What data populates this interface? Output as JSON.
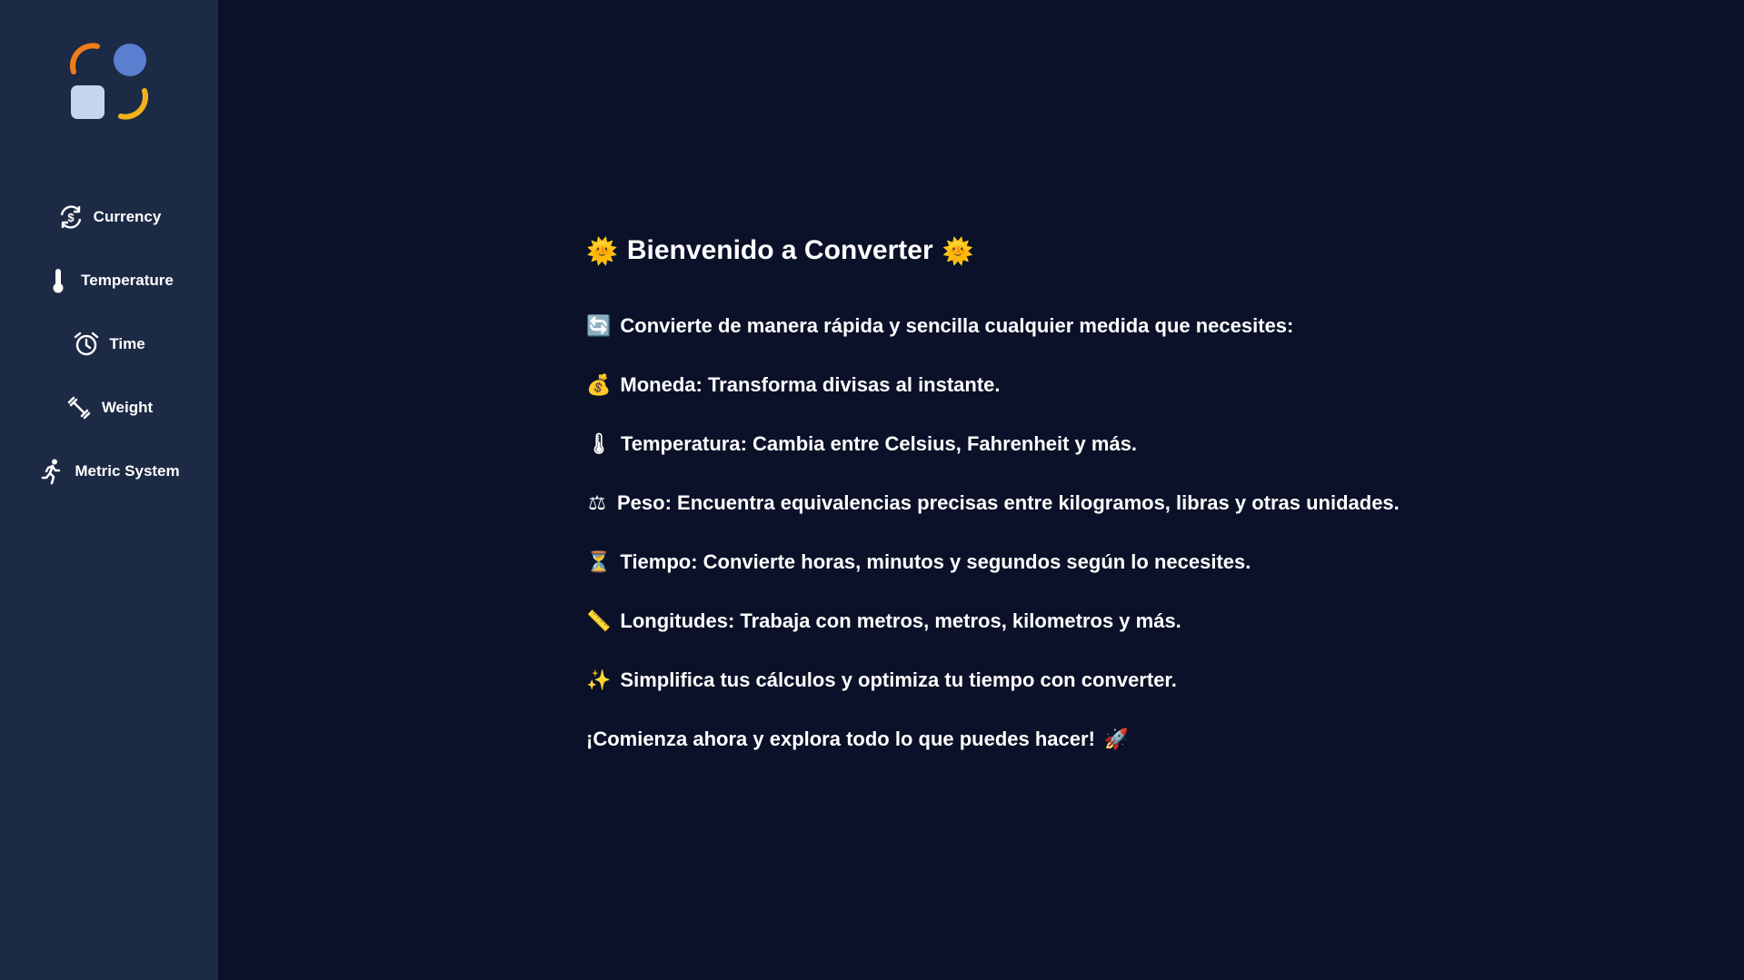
{
  "sidebar": {
    "items": [
      {
        "label": "Currency",
        "icon": "currency-exchange-icon"
      },
      {
        "label": "Temperature",
        "icon": "thermometer-icon"
      },
      {
        "label": "Time",
        "icon": "alarm-clock-icon"
      },
      {
        "label": "Weight",
        "icon": "dumbbell-icon"
      },
      {
        "label": "Metric System",
        "icon": "running-person-icon"
      }
    ]
  },
  "main": {
    "title": "Bienvenido a Converter",
    "title_emoji": "🌞",
    "lines": [
      {
        "emoji": "🔄",
        "text": "Convierte de manera rápida y sencilla cualquier medida que necesites:"
      },
      {
        "emoji": "💰",
        "text": "Moneda: Transforma divisas al instante."
      },
      {
        "emoji": "🌡",
        "text": "Temperatura: Cambia entre Celsius, Fahrenheit y más."
      },
      {
        "emoji": "⚖",
        "text": "Peso: Encuentra equivalencias precisas entre kilogramos, libras y otras unidades."
      },
      {
        "emoji": "⏳",
        "text": "Tiempo: Convierte horas, minutos y segundos según lo necesites."
      },
      {
        "emoji": "📏",
        "text": "Longitudes: Trabaja con metros, metros, kilometros y más."
      },
      {
        "emoji": "✨",
        "text": "Simplifica tus cálculos y optimiza tu tiempo con converter."
      }
    ],
    "cta": {
      "text": "¡Comienza ahora y explora todo lo que puedes hacer!",
      "emoji": "🚀"
    }
  },
  "colors": {
    "sidebar_bg": "#1d2a45",
    "main_bg": "#0a1128",
    "logo_orange": "#f07d1a",
    "logo_blue": "#5b7fd0",
    "logo_light": "#c7d4f0",
    "logo_yellow": "#f2b31a"
  }
}
